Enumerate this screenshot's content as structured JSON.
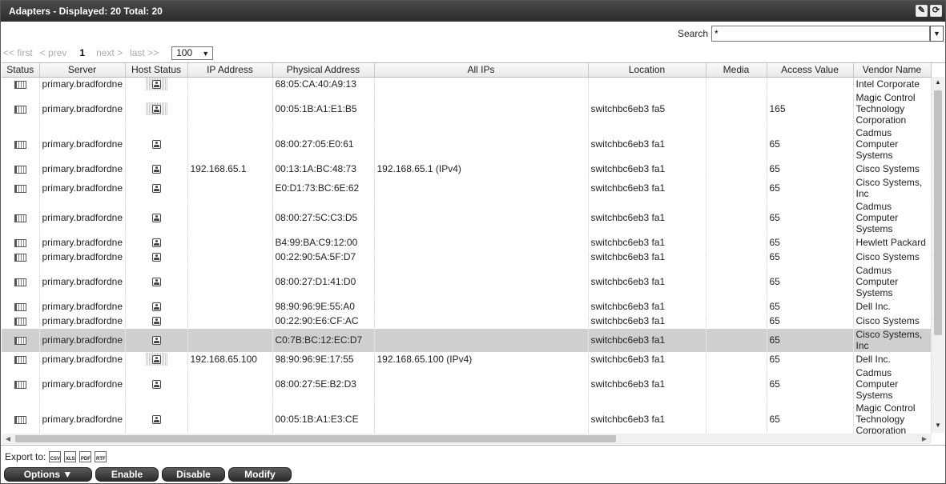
{
  "window": {
    "title": "Adapters - Displayed: 20 Total: 20"
  },
  "header_icons": [
    "edit-icon",
    "refresh-icon"
  ],
  "search": {
    "label": "Search",
    "value": "*"
  },
  "pager": {
    "first": "<< first",
    "prev": "< prev",
    "current": "1",
    "next": "next >",
    "last": "last >>",
    "page_size": "100"
  },
  "columns": [
    "Status",
    "Server",
    "Host Status",
    "IP Address",
    "Physical Address",
    "All IPs",
    "Location",
    "Media",
    "Access Value",
    "Vendor Name"
  ],
  "rows": [
    {
      "server": "primary.bradfordne",
      "host_status_dotted": true,
      "ip": "",
      "mac": "68:05:CA:40:A9:13",
      "all_ips": "",
      "location": "",
      "media": "",
      "access": "",
      "vendor": "Intel Corporate"
    },
    {
      "server": "primary.bradfordne",
      "host_status_dotted": true,
      "ip": "",
      "mac": "00:05:1B:A1:E1:B5",
      "all_ips": "",
      "location": "switchbc6eb3 fa5",
      "media": "",
      "access": "165",
      "vendor": "Magic Control Technology Corporation"
    },
    {
      "server": "primary.bradfordne",
      "host_status_dotted": false,
      "ip": "",
      "mac": "08:00:27:05:E0:61",
      "all_ips": "",
      "location": "switchbc6eb3 fa1",
      "media": "",
      "access": "65",
      "vendor": "Cadmus Computer Systems"
    },
    {
      "server": "primary.bradfordne",
      "host_status_dotted": false,
      "ip": "192.168.65.1",
      "mac": "00:13:1A:BC:48:73",
      "all_ips": "192.168.65.1 (IPv4)",
      "location": "switchbc6eb3 fa1",
      "media": "",
      "access": "65",
      "vendor": "Cisco Systems"
    },
    {
      "server": "primary.bradfordne",
      "host_status_dotted": false,
      "ip": "",
      "mac": "E0:D1:73:BC:6E:62",
      "all_ips": "",
      "location": "switchbc6eb3 fa1",
      "media": "",
      "access": "65",
      "vendor": "Cisco Systems, Inc"
    },
    {
      "server": "primary.bradfordne",
      "host_status_dotted": false,
      "ip": "",
      "mac": "08:00:27:5C:C3:D5",
      "all_ips": "",
      "location": "switchbc6eb3 fa1",
      "media": "",
      "access": "65",
      "vendor": "Cadmus Computer Systems"
    },
    {
      "server": "primary.bradfordne",
      "host_status_dotted": false,
      "ip": "",
      "mac": "B4:99:BA:C9:12:00",
      "all_ips": "",
      "location": "switchbc6eb3 fa1",
      "media": "",
      "access": "65",
      "vendor": "Hewlett Packard"
    },
    {
      "server": "primary.bradfordne",
      "host_status_dotted": false,
      "ip": "",
      "mac": "00:22:90:5A:5F:D7",
      "all_ips": "",
      "location": "switchbc6eb3 fa1",
      "media": "",
      "access": "65",
      "vendor": "Cisco Systems"
    },
    {
      "server": "primary.bradfordne",
      "host_status_dotted": false,
      "ip": "",
      "mac": "08:00:27:D1:41:D0",
      "all_ips": "",
      "location": "switchbc6eb3 fa1",
      "media": "",
      "access": "65",
      "vendor": "Cadmus Computer Systems"
    },
    {
      "server": "primary.bradfordne",
      "host_status_dotted": false,
      "ip": "",
      "mac": "98:90:96:9E:55:A0",
      "all_ips": "",
      "location": "switchbc6eb3 fa1",
      "media": "",
      "access": "65",
      "vendor": "Dell Inc."
    },
    {
      "server": "primary.bradfordne",
      "host_status_dotted": false,
      "ip": "",
      "mac": "00:22:90:E6:CF:AC",
      "all_ips": "",
      "location": "switchbc6eb3 fa1",
      "media": "",
      "access": "65",
      "vendor": "Cisco Systems"
    },
    {
      "server": "primary.bradfordne",
      "host_status_dotted": false,
      "ip": "",
      "mac": "C0:7B:BC:12:EC:D7",
      "all_ips": "",
      "location": "switchbc6eb3 fa1",
      "media": "",
      "access": "65",
      "vendor": "Cisco Systems, Inc",
      "selected": true
    },
    {
      "server": "primary.bradfordne",
      "host_status_dotted": true,
      "ip": "192.168.65.100",
      "mac": "98:90:96:9E:17:55",
      "all_ips": "192.168.65.100 (IPv4)",
      "location": "switchbc6eb3 fa1",
      "media": "",
      "access": "65",
      "vendor": "Dell Inc."
    },
    {
      "server": "primary.bradfordne",
      "host_status_dotted": false,
      "ip": "",
      "mac": "08:00:27:5E:B2:D3",
      "all_ips": "",
      "location": "switchbc6eb3 fa1",
      "media": "",
      "access": "65",
      "vendor": "Cadmus Computer Systems"
    },
    {
      "server": "primary.bradfordne",
      "host_status_dotted": false,
      "ip": "",
      "mac": "00:05:1B:A1:E3:CE",
      "all_ips": "",
      "location": "switchbc6eb3 fa1",
      "media": "",
      "access": "65",
      "vendor": "Magic Control Technology Corporation"
    }
  ],
  "footer": {
    "export_label": "Export to:",
    "export_formats": [
      "CSV",
      "XLS",
      "PDF",
      "RTF"
    ],
    "buttons": {
      "options": "Options",
      "enable": "Enable",
      "disable": "Disable",
      "modify": "Modify"
    }
  }
}
